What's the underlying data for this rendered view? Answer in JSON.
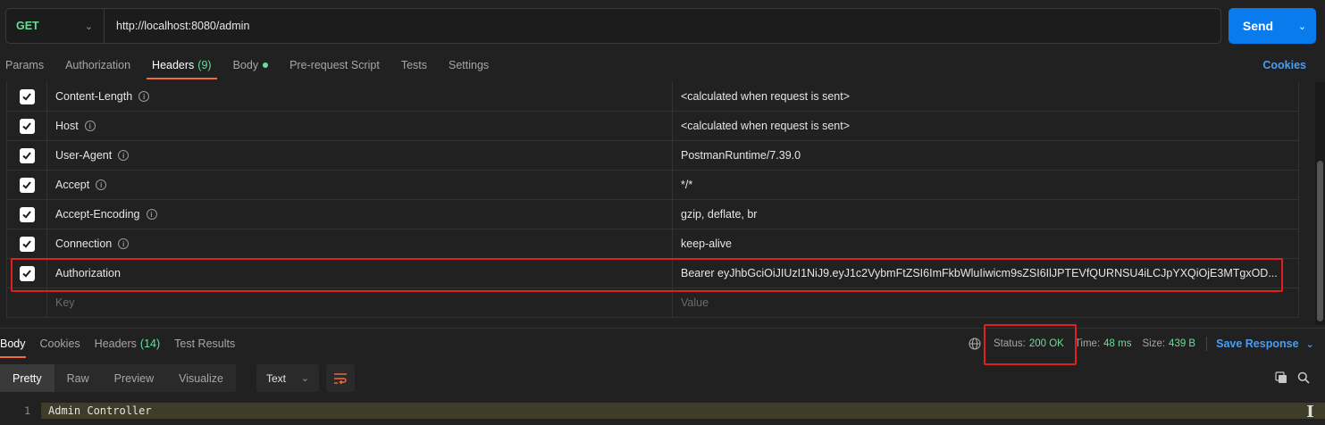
{
  "request": {
    "method": "GET",
    "url": "http://localhost:8080/admin",
    "send_label": "Send"
  },
  "request_tabs": [
    {
      "label": "Params"
    },
    {
      "label": "Authorization"
    },
    {
      "label": "Headers",
      "count": "(9)"
    },
    {
      "label": "Body"
    },
    {
      "label": "Pre-request Script"
    },
    {
      "label": "Tests"
    },
    {
      "label": "Settings"
    }
  ],
  "cookies_label": "Cookies",
  "headers": [
    {
      "key": "Content-Length",
      "value": "<calculated when request is sent>"
    },
    {
      "key": "Host",
      "value": "<calculated when request is sent>"
    },
    {
      "key": "User-Agent",
      "value": "PostmanRuntime/7.39.0"
    },
    {
      "key": "Accept",
      "value": "*/*"
    },
    {
      "key": "Accept-Encoding",
      "value": "gzip, deflate, br"
    },
    {
      "key": "Connection",
      "value": "keep-alive"
    },
    {
      "key": "Authorization",
      "value": "Bearer eyJhbGciOiJIUzI1NiJ9.eyJ1c2VybmFtZSI6ImFkbWluIiwicm9sZSI6IlJPTEVfQURNSU4iLCJpYXQiOjE3MTgxOD..."
    }
  ],
  "new_header": {
    "key_placeholder": "Key",
    "value_placeholder": "Value"
  },
  "response_tabs": [
    {
      "label": "Body"
    },
    {
      "label": "Cookies"
    },
    {
      "label": "Headers",
      "count": "(14)"
    },
    {
      "label": "Test Results"
    }
  ],
  "response_meta": {
    "status_label": "Status:",
    "status_value": "200 OK",
    "time_label": "Time:",
    "time_value": "48 ms",
    "size_label": "Size:",
    "size_value": "439 B",
    "save_label": "Save Response"
  },
  "format_buttons": [
    "Pretty",
    "Raw",
    "Preview",
    "Visualize"
  ],
  "format_select": "Text",
  "body_lines": [
    {
      "number": "1",
      "text": "Admin Controller"
    }
  ],
  "colors": {
    "accent_green": "#6bdd9a",
    "send_blue": "#097bed",
    "link_blue": "#4a9df2",
    "tab_underline": "#f26b3a",
    "highlight_red": "#e02020"
  }
}
